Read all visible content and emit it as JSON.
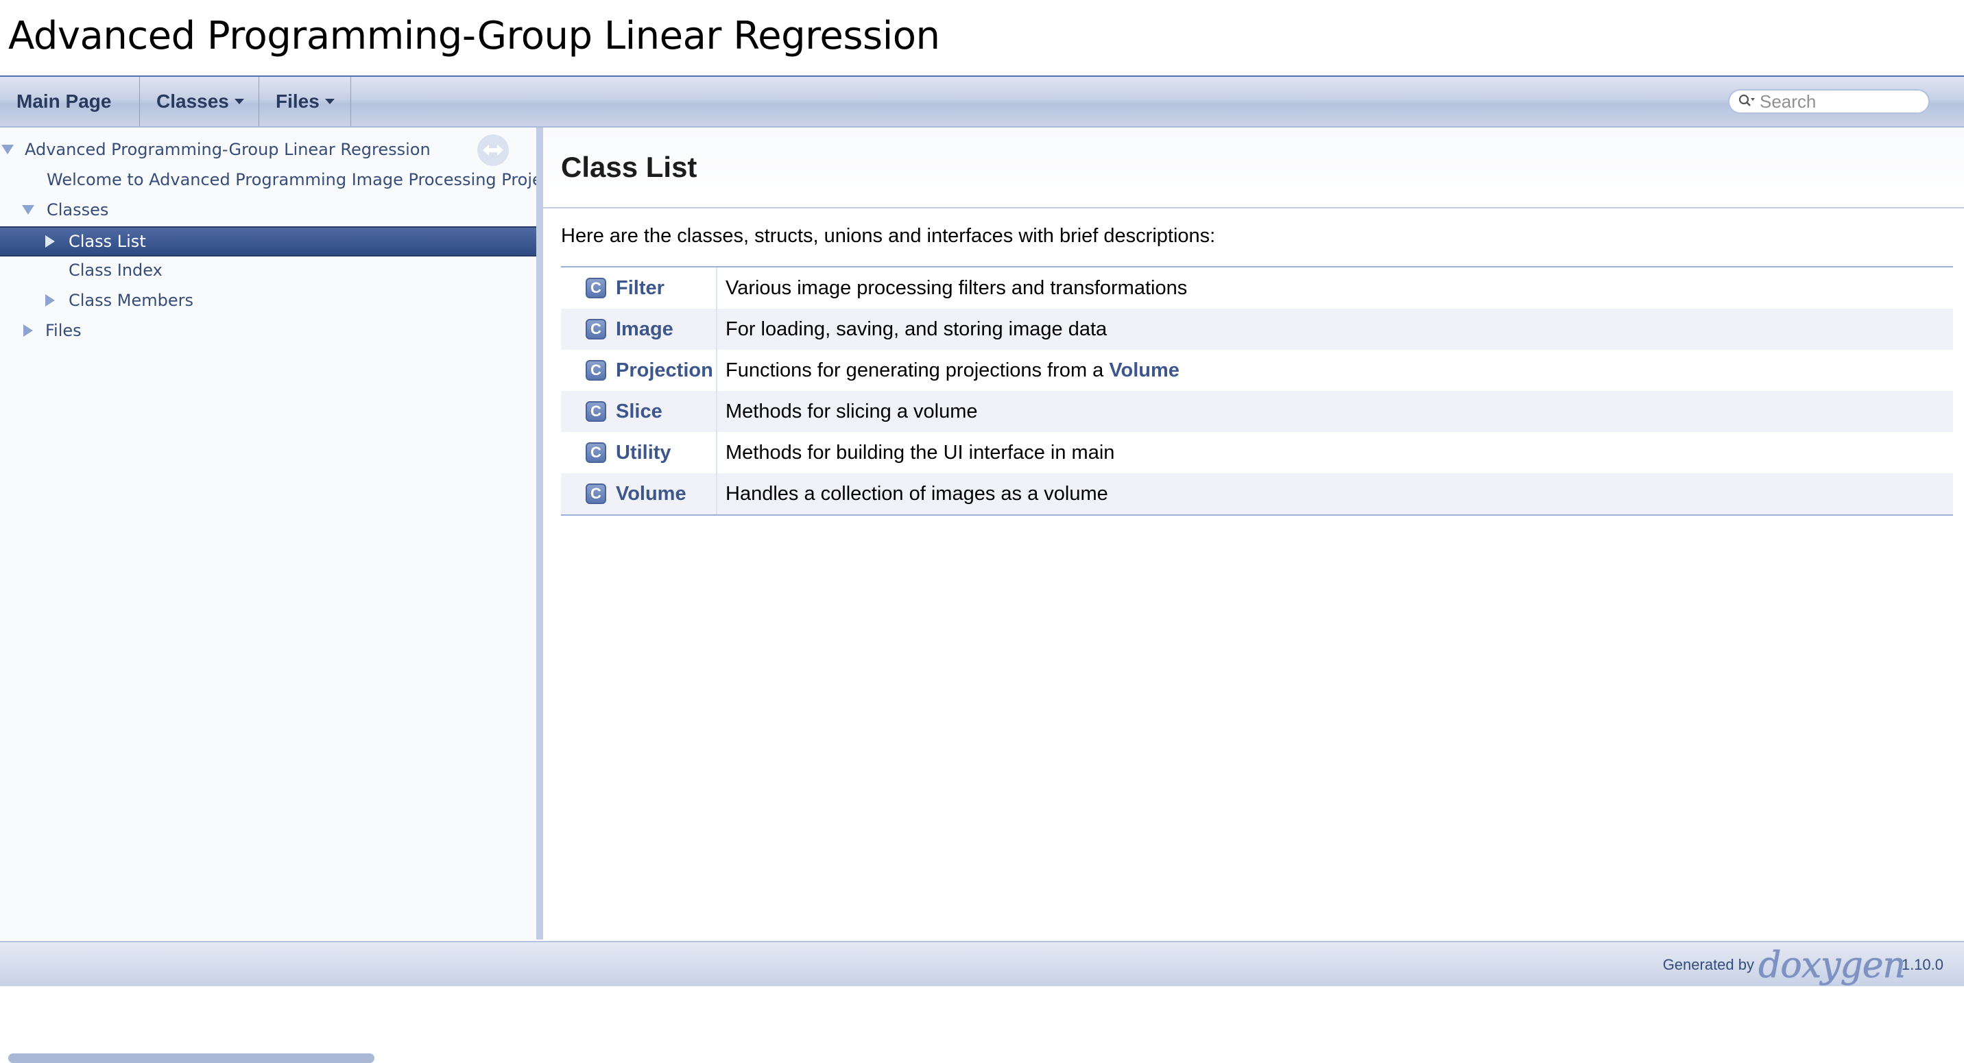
{
  "project": {
    "name": "Advanced Programming-Group Linear Regression"
  },
  "navbar": {
    "main_page": "Main Page",
    "classes": "Classes",
    "files": "Files",
    "search_placeholder": "Search"
  },
  "tree": {
    "root": "Advanced Programming-Group Linear Regression",
    "welcome": "Welcome to Advanced Programming Image Processing Project",
    "classes": "Classes",
    "class_list": "Class List",
    "class_index": "Class Index",
    "class_members": "Class Members",
    "files": "Files"
  },
  "content": {
    "title": "Class List",
    "intro": "Here are the classes, structs, unions and interfaces with brief descriptions:",
    "classes": [
      {
        "badge": "C",
        "name": "Filter",
        "description": "Various image processing filters and transformations"
      },
      {
        "badge": "C",
        "name": "Image",
        "description": "For loading, saving, and storing image data"
      },
      {
        "badge": "C",
        "name": "Projection",
        "description": "Functions for generating projections from a ",
        "link": "Volume"
      },
      {
        "badge": "C",
        "name": "Slice",
        "description": "Methods for slicing a volume"
      },
      {
        "badge": "C",
        "name": "Utility",
        "description": "Methods for building the UI interface in main"
      },
      {
        "badge": "C",
        "name": "Volume",
        "description": "Handles a collection of images as a volume"
      }
    ]
  },
  "footer": {
    "generated_by": "Generated by",
    "logo": "doxygen",
    "version": "1.10.0"
  }
}
